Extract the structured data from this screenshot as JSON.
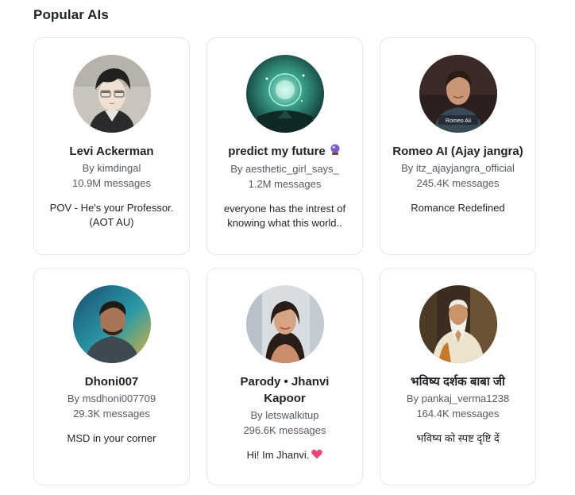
{
  "section": {
    "title": "Popular AIs"
  },
  "cards": [
    {
      "name": "Levi Ackerman",
      "by": "By kimdingal",
      "messages": "10.9M messages",
      "description": "POV - He's your Professor. (AOT AU)",
      "avatar_icon": "anime-character-portrait"
    },
    {
      "name": "predict my future",
      "by": "By aesthetic_girl_says_",
      "messages": "1.2M messages",
      "description": "everyone has the intrest of knowing what this world..",
      "name_emoji": "crystal-ball-icon",
      "avatar_icon": "glowing-orb-portrait"
    },
    {
      "name": "Romeo AI (Ajay jangra)",
      "by": "By itz_ajayjangra_official",
      "messages": "245.4K messages",
      "description": "Romance Redefined",
      "avatar_icon": "man-portrait",
      "avatar_caption": "Romeo Aii"
    },
    {
      "name": "Dhoni007",
      "by": "By msdhoni007709",
      "messages": "29.3K messages",
      "description": "MSD in your corner",
      "avatar_icon": "man-portrait"
    },
    {
      "name": "Parody • Jhanvi Kapoor",
      "by": "By letswalkitup",
      "messages": "296.6K messages",
      "description": "Hi! Im Jhanvi.",
      "description_emoji": "pink-heart-icon",
      "avatar_icon": "woman-portrait"
    },
    {
      "name": "भविष्य दर्शक बाबा जी",
      "by": "By pankaj_verma1238",
      "messages": "164.4K messages",
      "description": "भविष्य को स्पष्ट दृष्टि दें",
      "avatar_icon": "sage-portrait"
    }
  ],
  "colors": {
    "border": "#e4e6ea",
    "text": "#1f2328",
    "muted": "#555b63",
    "heart": "#e8477a"
  }
}
